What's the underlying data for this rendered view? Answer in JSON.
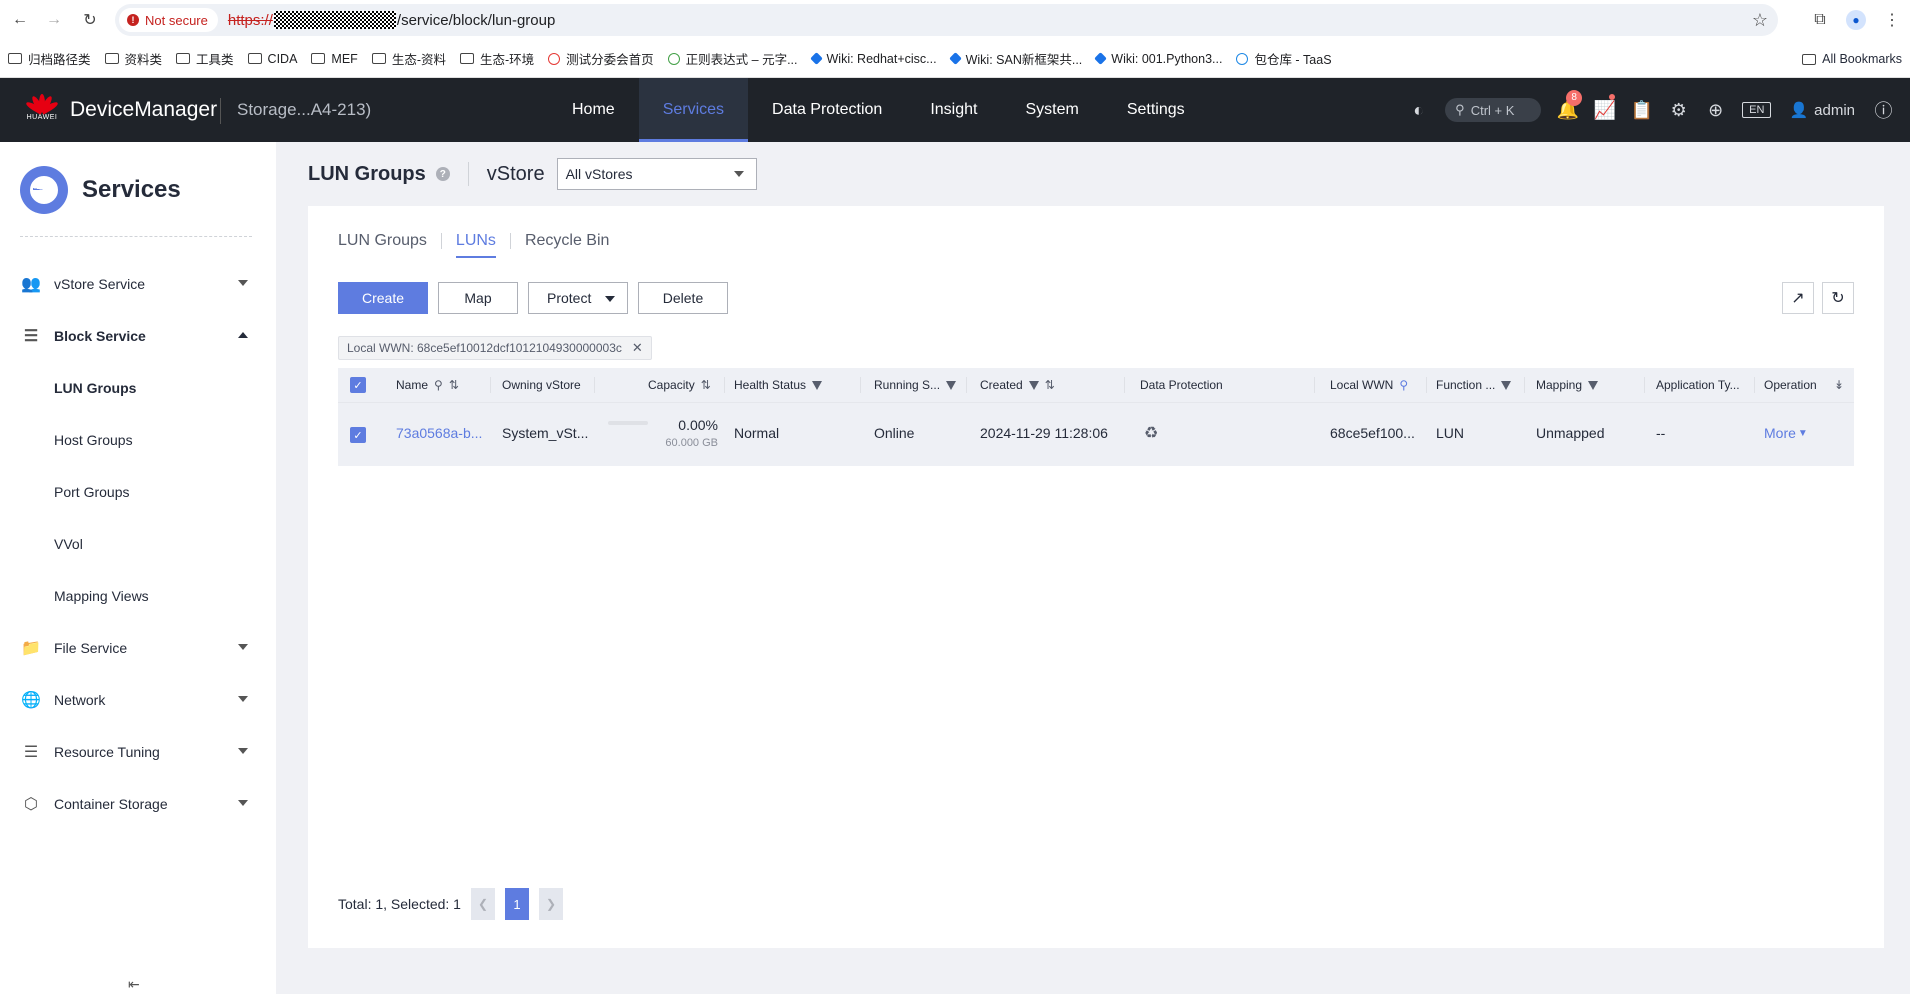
{
  "browser": {
    "security_label": "Not secure",
    "url_scheme": "https://",
    "url_path": "/service/block/lun-group",
    "bookmarks": [
      {
        "label": "归档路径类",
        "icon": "folder-icon"
      },
      {
        "label": "资料类",
        "icon": "folder-icon"
      },
      {
        "label": "工具类",
        "icon": "folder-icon"
      },
      {
        "label": "CIDA",
        "icon": "folder-icon"
      },
      {
        "label": "MEF",
        "icon": "folder-icon"
      },
      {
        "label": "生态-资料",
        "icon": "folder-icon"
      },
      {
        "label": "生态-环境",
        "icon": "folder-icon"
      },
      {
        "label": "测试分委会首页",
        "icon": "site-icon"
      },
      {
        "label": "正则表达式 – 元字...",
        "icon": "site-icon"
      },
      {
        "label": "Wiki: Redhat+cisc...",
        "icon": "wiki-icon"
      },
      {
        "label": "Wiki: SAN新框架共...",
        "icon": "wiki-icon"
      },
      {
        "label": "Wiki: 001.Python3...",
        "icon": "wiki-icon"
      },
      {
        "label": "包仓库 - TaaS",
        "icon": "site-icon"
      }
    ],
    "all_bookmarks": "All Bookmarks"
  },
  "header": {
    "brand": "HUAWEI",
    "app_name": "DeviceManager",
    "device_name": "Storage...A4-213)",
    "nav": [
      "Home",
      "Services",
      "Data Protection",
      "Insight",
      "System",
      "Settings"
    ],
    "active_nav": "Services",
    "search_hint": "Ctrl + K",
    "alert_count": "8",
    "language": "EN",
    "user": "admin"
  },
  "sidebar": {
    "title": "Services",
    "items": [
      {
        "label": "vStore Service",
        "icon": "users-icon"
      },
      {
        "label": "Block Service",
        "icon": "database-icon"
      },
      {
        "label": "File Service",
        "icon": "folder-icon"
      },
      {
        "label": "Network",
        "icon": "globe-icon"
      },
      {
        "label": "Resource Tuning",
        "icon": "layers-icon"
      },
      {
        "label": "Container Storage",
        "icon": "hexagons-icon"
      }
    ],
    "block_sub": [
      "LUN Groups",
      "Host Groups",
      "Port Groups",
      "VVol",
      "Mapping Views"
    ]
  },
  "page": {
    "title": "LUN Groups",
    "vstore_label": "vStore",
    "vstore_value": "All vStores",
    "tabs": [
      "LUN Groups",
      "LUNs",
      "Recycle Bin"
    ],
    "active_tab": "LUNs",
    "buttons": {
      "create": "Create",
      "map": "Map",
      "protect": "Protect",
      "delete": "Delete"
    },
    "filter_tag": "Local WWN: 68ce5ef10012dcf1012104930000003c"
  },
  "table": {
    "columns": [
      "Name",
      "Owning vStore",
      "Capacity",
      "Health Status",
      "Running S...",
      "Created",
      "Data Protection",
      "Local WWN",
      "Function ...",
      "Mapping",
      "Application Ty...",
      "Operation"
    ],
    "rows": [
      {
        "name": "73a0568a-b...",
        "owning_vstore": "System_vSt...",
        "capacity_pct": "0.00%",
        "capacity_total": "60.000 GB",
        "capacity_fraction": 0,
        "health": "Normal",
        "running": "Online",
        "created": "2024-11-29 11:28:06",
        "data_protection_icon": "protection-icon",
        "local_wwn": "68ce5ef100...",
        "function": "LUN",
        "mapping": "Unmapped",
        "app_type": "--",
        "operation": "More"
      }
    ]
  },
  "pagination": {
    "summary": "Total: 1, Selected: 1",
    "current_page": "1"
  }
}
